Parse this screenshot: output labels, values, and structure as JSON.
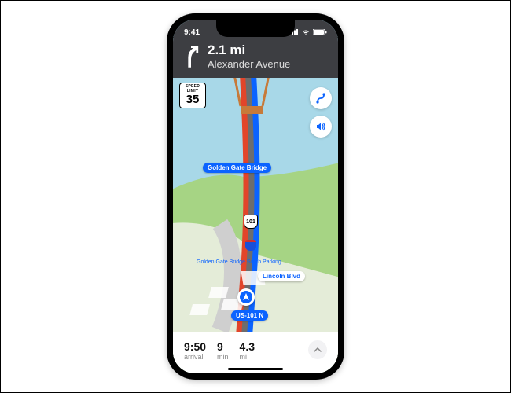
{
  "status_bar": {
    "time": "9:41"
  },
  "banner": {
    "distance": "2.1 mi",
    "road": "Alexander Avenue"
  },
  "speed_limit": {
    "label": "SPEED LIMIT",
    "value": "35"
  },
  "labels": {
    "bridge": "Golden Gate Bridge",
    "poi_parking": "Golden Gate Bridge South Parking",
    "street_lincoln": "Lincoln Blvd",
    "hwy_pill": "US-101 N",
    "shield_101": "101"
  },
  "tray": {
    "arrival_value": "9:50",
    "arrival_label": "arrival",
    "time_value": "9",
    "time_label": "min",
    "dist_value": "4.3",
    "dist_label": "mi"
  },
  "colors": {
    "route_active": "#0b63ff",
    "route_traffic": "#e2452a",
    "banner_bg": "#3d3e42",
    "land": "#9acb6a",
    "water": "#a8d8e8"
  }
}
